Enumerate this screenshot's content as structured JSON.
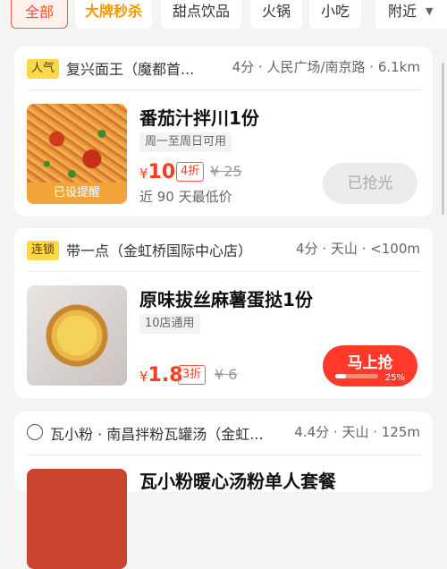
{
  "tabs": [
    "全部",
    "大牌秒杀",
    "甜点饮品",
    "火锅",
    "小吃",
    "附近"
  ],
  "deals": [
    {
      "badge": "人气",
      "store": "复兴面王（魔都首...",
      "meta": "4分 · 人民广场/南京路 · 6.1km",
      "title": "番茄汁拌川1份",
      "tag": "周一至周日可用",
      "yen": "¥",
      "price": "10",
      "discount": "4折",
      "original": "¥ 25",
      "low_price_note": "近 90 天最低价",
      "reminder": "已设提醒",
      "button": "已抢光",
      "thumb": "noodle-dish"
    },
    {
      "badge": "连锁",
      "store": "带一点（金虹桥国际中心店）",
      "meta": "4分 · 天山 · <100m",
      "title": "原味拔丝麻薯蛋挞1份",
      "tag": "10店通用",
      "yen": "¥",
      "price": "1.8",
      "discount": "3折",
      "original": "¥ 6",
      "button": "马上抢",
      "progress_label": "25%",
      "progress": 0.25,
      "thumb": "egg-tart"
    },
    {
      "store": "瓦小粉 · 南昌拌粉瓦罐汤（金虹...",
      "meta": "4.4分 · 天山 · 125m",
      "title": "瓦小粉暖心汤粉单人套餐",
      "icon": "store-icon"
    }
  ],
  "colors": {
    "accent": "#ff3a2a",
    "brand": "#f29a00",
    "badge": "#ffd84a"
  }
}
